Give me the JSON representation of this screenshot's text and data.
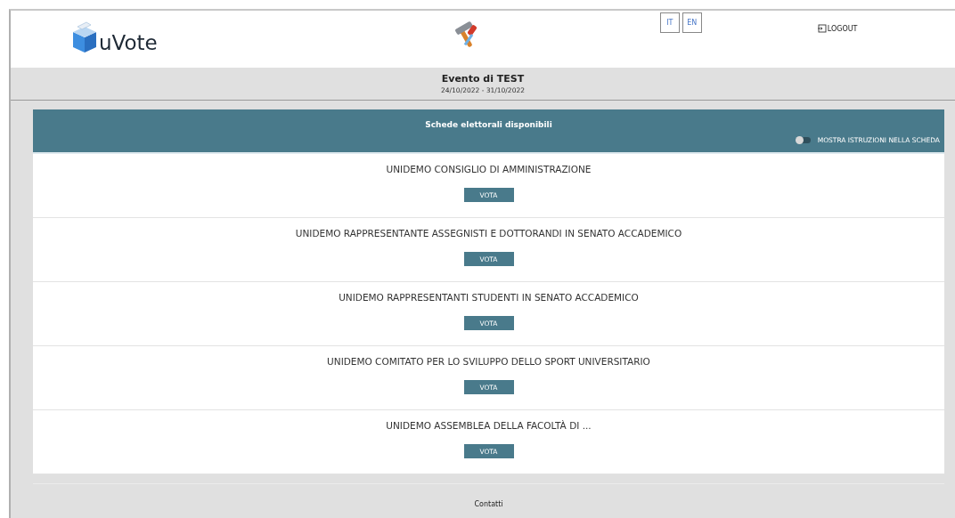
{
  "header": {
    "logo_text": "uVote",
    "languages": [
      "IT",
      "EN"
    ],
    "logout": "LOGOUT"
  },
  "event": {
    "title": "Evento di TEST",
    "dates": "24/10/2022 - 31/10/2022"
  },
  "panel": {
    "title": "Schede elettorali disponibili",
    "toggle": {
      "label": "MOSTRA ISTRUZIONI NELLA SCHEDA",
      "on": false
    }
  },
  "ballots": [
    {
      "title": "UNIDEMO CONSIGLIO DI AMMINISTRAZIONE",
      "button": "VOTA"
    },
    {
      "title": "UNIDEMO RAPPRESENTANTE ASSEGNISTI E DOTTORANDI IN SENATO ACCADEMICO",
      "button": "VOTA"
    },
    {
      "title": "UNIDEMO RAPPRESENTANTI STUDENTI IN SENATO ACCADEMICO",
      "button": "VOTA"
    },
    {
      "title": "UNIDEMO COMITATO PER LO SVILUPPO DELLO SPORT UNIVERSITARIO",
      "button": "VOTA"
    },
    {
      "title": "UNIDEMO ASSEMBLEA DELLA FACOLTÀ DI ...",
      "button": "VOTA"
    }
  ],
  "footer": {
    "link": "Contatti"
  }
}
